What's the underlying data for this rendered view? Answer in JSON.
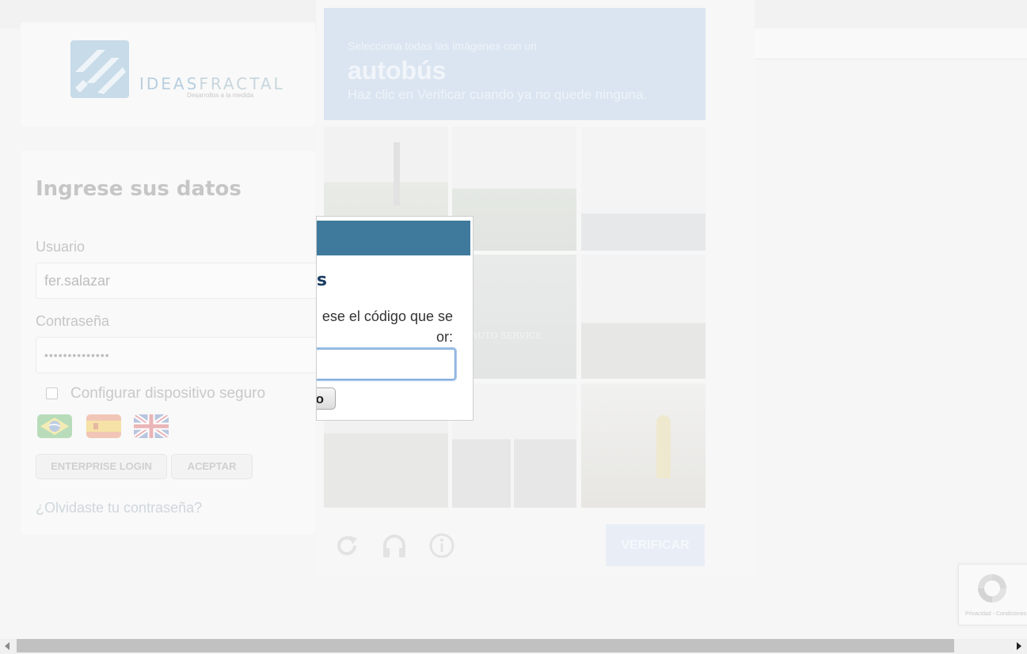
{
  "logo": {
    "name_part1": "IDEAS",
    "name_part2": "FRACTAL",
    "tagline": "Desarrollos a la medida"
  },
  "login": {
    "title": "Ingrese sus datos",
    "user_label": "Usuario",
    "user_value": "fer.salazar",
    "password_label": "Contraseña",
    "password_value": "••••••••••••••",
    "secure_device_label": "Configurar dispositivo seguro",
    "secure_device_checked": false,
    "languages": [
      "pt-BR flag",
      "es flag",
      "en-GB flag"
    ],
    "enterprise_login_label": "ENTERPRISE LOGIN",
    "accept_label": "ACEPTAR",
    "forgot_label": "¿Olvidaste tu contraseña?"
  },
  "captcha": {
    "subtitle": "Selecciona todas las imágenes con un",
    "target": "autobús",
    "instruction": "Haz clic en Verificar cuando ya no quede ninguna.",
    "tile_sign_text": "AUTO SERVICE",
    "verify_label": "VERIFICAR",
    "icons": [
      "reload-icon",
      "headphones-icon",
      "info-icon"
    ]
  },
  "modal": {
    "title_visible": "s",
    "text_line1": "ese el código que se",
    "text_line2": "or:",
    "code_value": "",
    "button_visible": "o"
  },
  "badge": {
    "text": "Privacidad - Condiciones"
  },
  "colors": {
    "modal_bar": "#3f7a9c",
    "modal_title": "#1b3e63",
    "input_focus": "#a9c7ea"
  }
}
